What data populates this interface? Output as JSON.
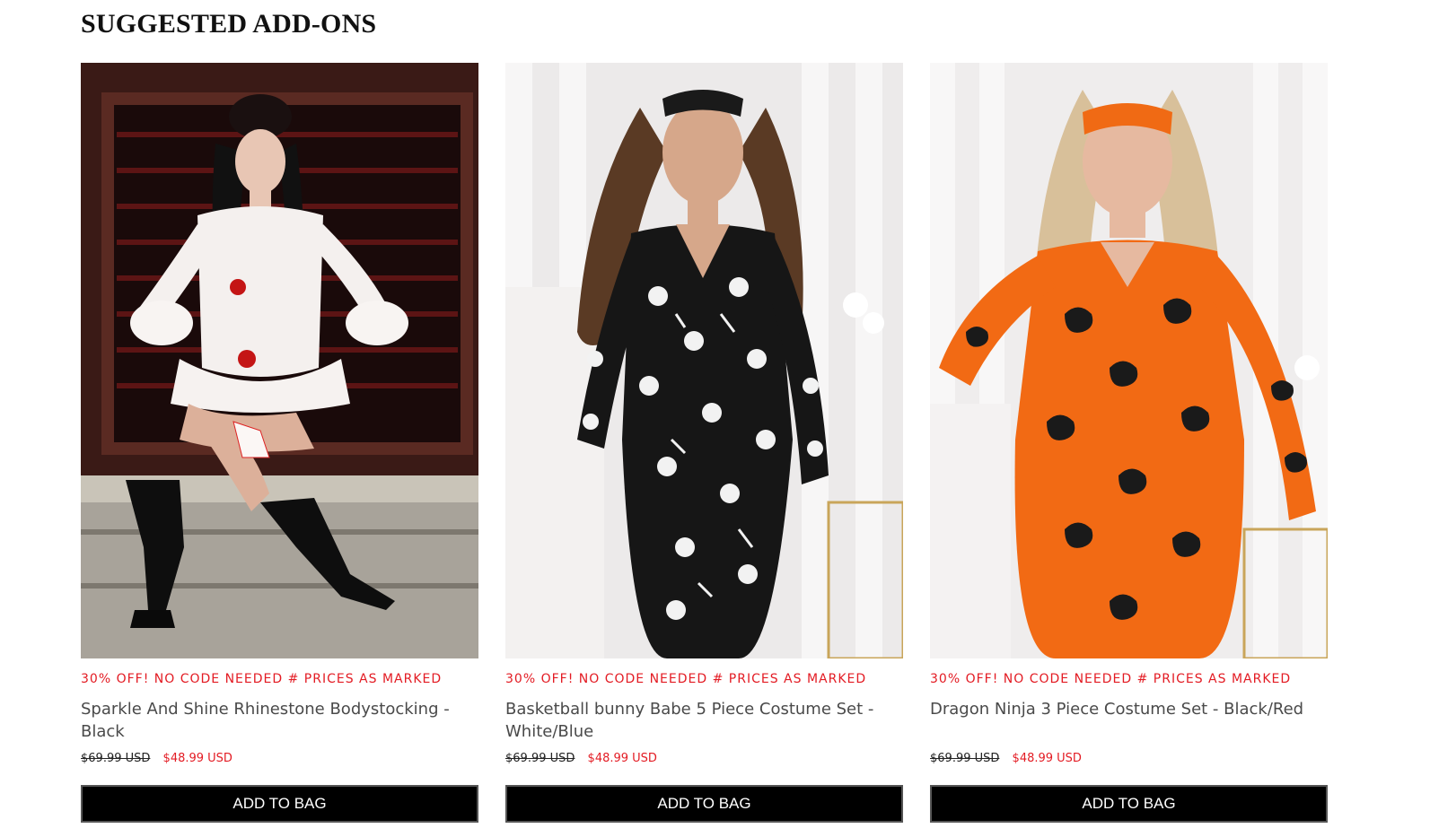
{
  "section": {
    "title": "SUGGESTED ADD-ONS"
  },
  "products": [
    {
      "promo": "30% OFF! NO CODE NEEDED # PRICES AS MARKED",
      "name": "Sparkle And Shine Rhinestone Bodystocking - Black",
      "old_price": "$69.99 USD",
      "new_price": "$48.99 USD",
      "button_label": "ADD TO BAG",
      "image_alt": "clown-costume-photo"
    },
    {
      "promo": "30% OFF! NO CODE NEEDED # PRICES AS MARKED",
      "name": "Basketball bunny Babe 5 Piece Costume Set - White/Blue",
      "old_price": "$69.99 USD",
      "new_price": "$48.99 USD",
      "button_label": "ADD TO BAG",
      "image_alt": "skeleton-jumpsuit-photo"
    },
    {
      "promo": "30% OFF! NO CODE NEEDED # PRICES AS MARKED",
      "name": "Dragon Ninja 3 Piece Costume Set - Black/Red",
      "old_price": "$69.99 USD",
      "new_price": "$48.99 USD",
      "button_label": "ADD TO BAG",
      "image_alt": "black-cat-jumpsuit-photo"
    }
  ],
  "colors": {
    "promo_red": "#e31b23",
    "button_bg": "#000000",
    "title_text": "#111111"
  }
}
